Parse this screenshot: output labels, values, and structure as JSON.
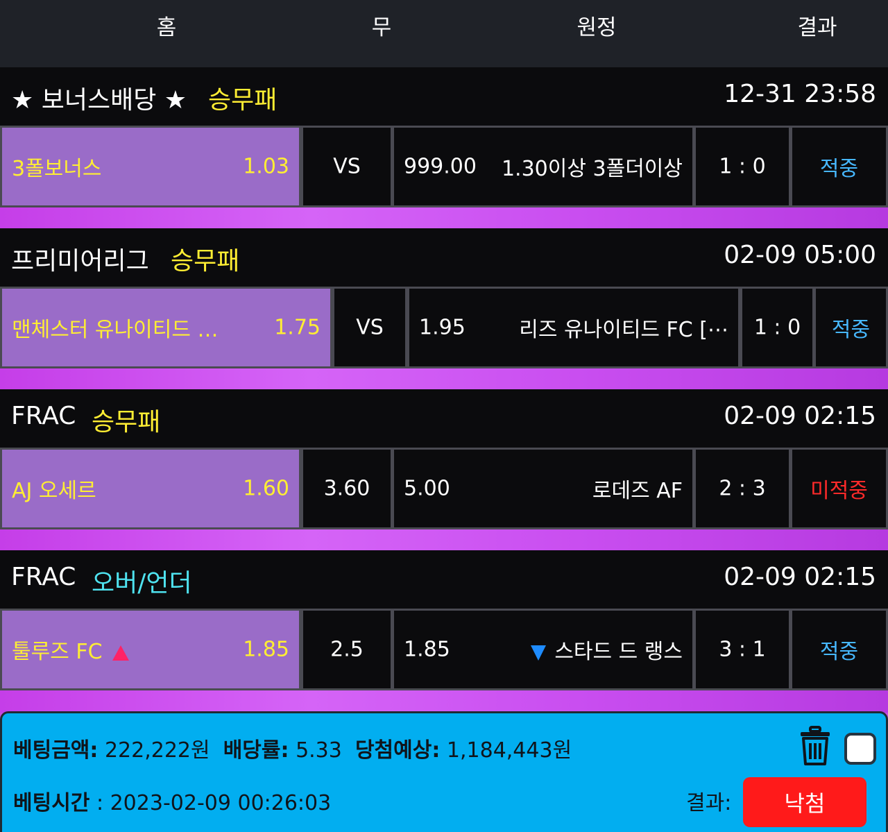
{
  "header": {
    "home": "홈",
    "draw": "무",
    "away": "원정",
    "result": "결과"
  },
  "colors": {
    "accent_yellow": "#ffee33",
    "accent_cyan": "#4fe3f0",
    "hit_blue": "#47b8ff",
    "miss_red": "#ff2a2a",
    "home_cell": "#9a6cc8",
    "summary_bg": "#02aef0",
    "result_badge": "#ff1a1a"
  },
  "bets": [
    {
      "league": "★ 보너스배당 ★",
      "type": "승무패",
      "time": "12-31 23:58",
      "home": "3폴보너스",
      "home_odds": "1.03",
      "mid": "VS",
      "away_odds": "999.00",
      "away": "1.30이상 3폴더이상",
      "score": "1 : 0",
      "result": "적중"
    },
    {
      "league": "프리미어리그",
      "type": "승무패",
      "time": "02-09 05:00",
      "home": "맨체스터 유나이티드 …",
      "home_odds": "1.75",
      "mid": "VS",
      "away_odds": "1.95",
      "away": "리즈 유나이티드 FC [⋯",
      "score": "1 : 0",
      "result": "적중"
    },
    {
      "league": "FRAC",
      "type": "승무패",
      "time": "02-09 02:15",
      "home": "AJ 오세르",
      "home_odds": "1.60",
      "mid": "3.60",
      "away_odds": "5.00",
      "away": "로데즈 AF",
      "score": "2 : 3",
      "result": "미적중"
    },
    {
      "league": "FRAC",
      "type": "오버/언더",
      "time": "02-09 02:15",
      "home": "툴루즈 FC",
      "home_odds": "1.85",
      "mid": "2.5",
      "away_odds": "1.85",
      "away": "스타드 드 랭스",
      "score": "3 : 1",
      "result": "적중",
      "home_icon": "triangle-up-icon",
      "away_icon": "triangle-down-icon"
    }
  ],
  "summary": {
    "bet_amount_label": "베팅금액:",
    "bet_amount": "222,222원",
    "odds_label": "배당률:",
    "odds": "5.33",
    "expected_label": "당첨예상:",
    "expected": "1,184,443원",
    "bet_time_label": "베팅시간",
    "bet_time": ": 2023-02-09 00:26:03",
    "result_label": "결과:",
    "result_value": "낙첨",
    "trash_icon": "trash-icon"
  }
}
